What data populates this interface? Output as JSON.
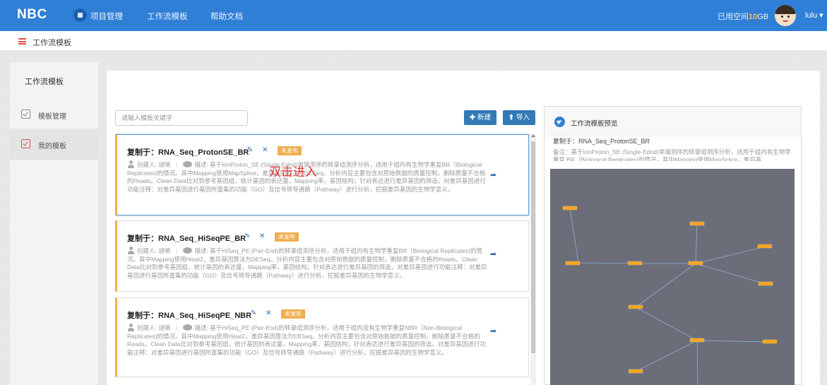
{
  "topbar": {
    "brand": "NBC",
    "nav": [
      "项目管理",
      "工作流模板",
      "帮助文档"
    ],
    "space_label": "已用空间",
    "space_value": "10",
    "space_unit": "GB",
    "username": "lulu ▾"
  },
  "breadcrumb": {
    "label": "工作流模板"
  },
  "sidebar": {
    "title": "工作流模板",
    "items": [
      {
        "label": "模板管理",
        "active": false
      },
      {
        "label": "我的模板",
        "active": true
      }
    ]
  },
  "toolbar": {
    "search_placeholder": "请输入模板关键字",
    "new_label": "新建",
    "import_label": "导入"
  },
  "cards": [
    {
      "title": "复制于：RNA_Seq_ProtonSE_BR",
      "badge": "未发布",
      "creator": "创建人: 谜嘀",
      "desc": "描述: 基于IonProton_SE (Single-Ednd)单端测序的转录组测序分析，适用于组内有生物学重复BR（Biological Replicates)的情况。其中Mapping使用MapSplice，差异基因算法为DESeq。分析内容主要包含对原始数据的质量控制，删除质量不合格的Reads。Clean Data比对到参考基因组，统计基因的表达量，Mapping率，基因结构；针对表达进行差异基因的筛选，对差异基因进行功能注释：对差异基因进行基因所富集的功能（GO）及信号转导通路（Pathway）进行分析，挖掘差异基因的生物学意义。",
      "selected": true
    },
    {
      "title": "复制于：RNA_Seq_HiSeqPE_BR",
      "badge": "未发布",
      "creator": "创建人: 谜嘀",
      "desc": "描述: 基于HiSeq_PE (Pair-End)的转录组测序分析，适用于组内有生物学重复BR（Biological Replicates)的情况。其中Mapping使用Hisat2，差异基因算法为DESeq。分析内容主要包含对原始数据的质量控制，删除质量不合格的Reads。Clean Data比对到参考基因组，统计基因的表达量，Mapping率，基因结构；针对表达进行差异基因的筛选，对差异基因进行功能注释：对差异基因进行基因所富集的功能（GO）及信号转导通路（Pathway）进行分析，挖掘差异基因的生物学意义。",
      "selected": false
    },
    {
      "title": "复制于：RNA_Seq_HiSeqPE_NBR",
      "badge": "未发布",
      "creator": "创建人: 谜嘀",
      "desc": "描述: 基于HiSeq_PE (Pair-End)的转录组测序分析，适用于组内没有生物学重复NBR（Non-Biological Replicates)的情况。其中Mapping使用Hisat2，差异基因算法为EBSeq。分析内容主要包含对原始数据的质量控制，删除质量不合格的Reads。Clean Data比对到参考基因组，统计基因的表达量，Mapping率，基因结构；针对表达进行差异基因的筛选，对差异基因进行功能注释：对差异基因进行基因所富集的功能（GO）及信号转导通路（Pathway）进行分析，挖掘差异基因的生物学意义。",
      "selected": false
    }
  ],
  "overlay_hint": "双击进入",
  "preview": {
    "title": "工作流模板预览",
    "copy_of": "复制于：RNA_Seq_ProtonSE_BR",
    "note": "备注：基于IonProton_SE (Single-Ednd)单端测序的转录组测序分析，适用于组内有生物学重复 BR（Biological Replicates)的情况。其中Mapping使用MapSplice，差异基"
  }
}
